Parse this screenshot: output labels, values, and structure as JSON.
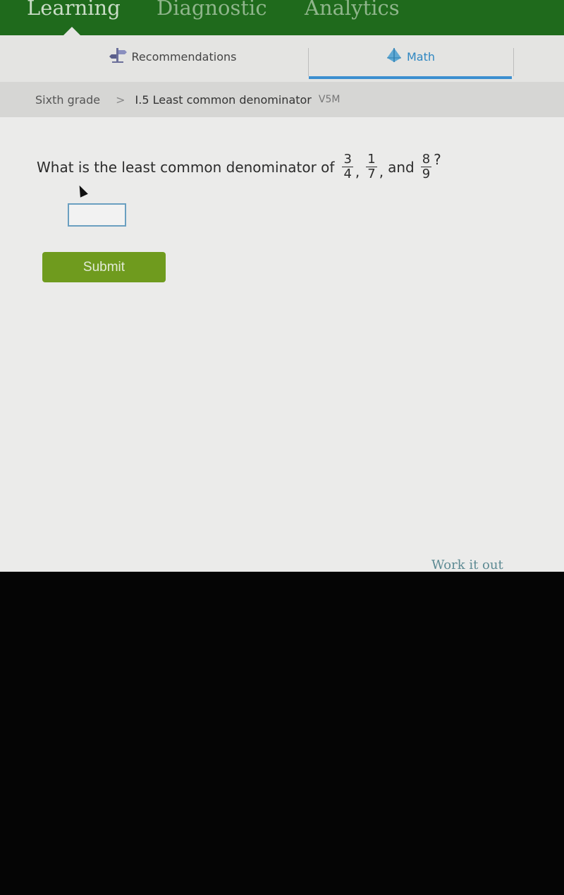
{
  "topnav": {
    "items": [
      {
        "label": "Learning",
        "active": true
      },
      {
        "label": "Diagnostic",
        "active": false
      },
      {
        "label": "Analytics",
        "active": false
      }
    ]
  },
  "subnav": {
    "tabs": [
      {
        "label": "Recommendations",
        "icon": "recommendations-icon",
        "active": false
      },
      {
        "label": "Math",
        "icon": "math-pyramid-icon",
        "active": true
      }
    ],
    "accent_color": "#3c8fd0"
  },
  "breadcrumb": {
    "grade": "Sixth grade",
    "separator": ">",
    "skill": "I.5 Least common denominator",
    "code": "V5M"
  },
  "question": {
    "prefix": "What is the least common denominator of",
    "fractions": [
      {
        "numerator": "3",
        "denominator": "4"
      },
      {
        "numerator": "1",
        "denominator": "7"
      },
      {
        "numerator": "8",
        "denominator": "9"
      }
    ],
    "comma": ",",
    "and": "and",
    "suffix": "?"
  },
  "answer": {
    "value": "",
    "placeholder": ""
  },
  "submit_label": "Submit",
  "footer_link": "Work it out",
  "colors": {
    "topnav": "#1f6a1c",
    "submit": "#6f9b1e"
  }
}
